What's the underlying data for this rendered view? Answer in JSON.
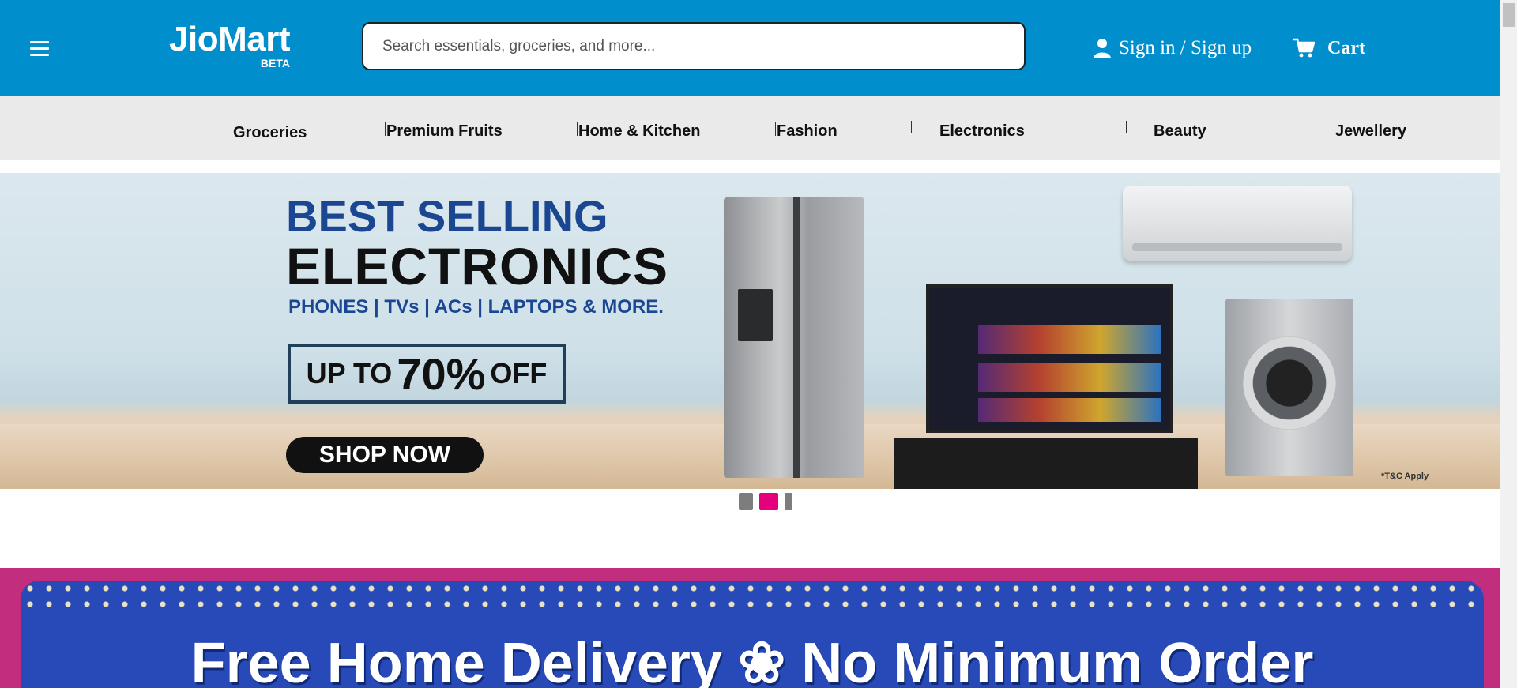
{
  "header": {
    "logo_main": "JioMart",
    "logo_sub": "BETA",
    "search_placeholder": "Search essentials, groceries, and more...",
    "signin_label": "Sign in / Sign up",
    "cart_label": "Cart",
    "bg_color": "#008ecc"
  },
  "categories": [
    {
      "label": "Groceries"
    },
    {
      "label": "Premium Fruits"
    },
    {
      "label": "Home & Kitchen"
    },
    {
      "label": "Fashion"
    },
    {
      "label": "Electronics"
    },
    {
      "label": "Beauty"
    },
    {
      "label": "Jewellery"
    }
  ],
  "banner": {
    "line1": "BEST SELLING",
    "line2": "ELECTRONICS",
    "line3": "PHONES | TVs | ACs | LAPTOPS & MORE.",
    "offer_prefix": "UP TO",
    "offer_value": "70%",
    "offer_suffix": "OFF",
    "cta": "SHOP NOW",
    "terms": "*T&C Apply",
    "active_slide": 2,
    "slide_count": 3
  },
  "promo": {
    "text": "Free Home Delivery ❀ No Minimum Order"
  },
  "icons": {
    "menu": "hamburger-icon",
    "user": "user-icon",
    "cart": "cart-icon"
  }
}
